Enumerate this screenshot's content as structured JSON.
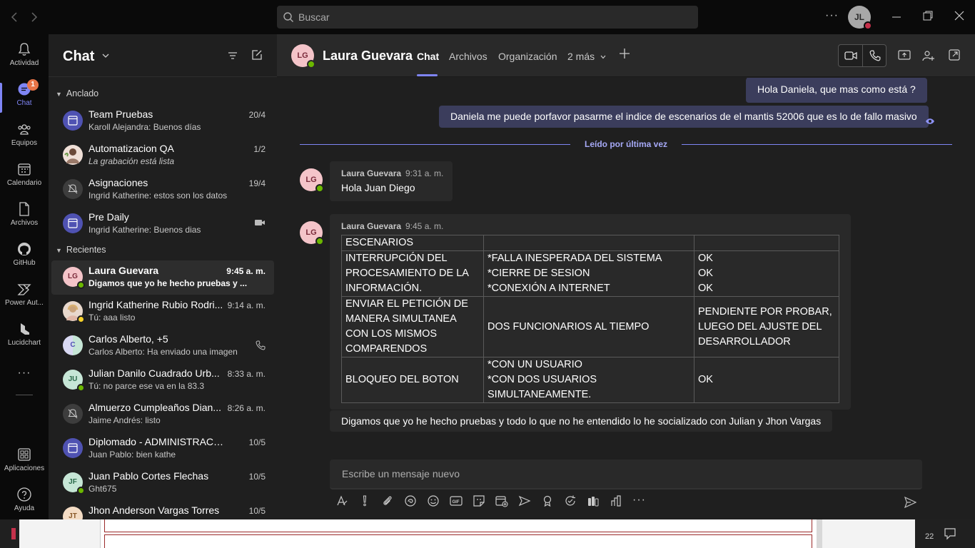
{
  "titlebar": {
    "search_placeholder": "Buscar",
    "more": "···",
    "user_initials": "JL"
  },
  "rail": {
    "items": [
      {
        "label": "Actividad",
        "icon": "bell-icon"
      },
      {
        "label": "Chat",
        "icon": "chat-icon",
        "badge": "1"
      },
      {
        "label": "Equipos",
        "icon": "teams-icon"
      },
      {
        "label": "Calendario",
        "icon": "calendar-icon"
      },
      {
        "label": "Archivos",
        "icon": "file-icon"
      },
      {
        "label": "GitHub",
        "icon": "github-icon"
      },
      {
        "label": "Power Aut...",
        "icon": "power-automate-icon"
      },
      {
        "label": "Lucidchart",
        "icon": "lucidchart-icon"
      }
    ],
    "more": "···",
    "bottom": [
      {
        "label": "Aplicaciones",
        "icon": "apps-icon"
      },
      {
        "label": "Ayuda",
        "icon": "help-icon"
      }
    ]
  },
  "chatlist": {
    "title": "Chat",
    "pinned_label": "Anclado",
    "recent_label": "Recientes",
    "pinned": [
      {
        "name": "Team Pruebas",
        "preview": "Karoll Alejandra: Buenos días",
        "time": "20/4"
      },
      {
        "name": "Automatizacion QA",
        "preview": "La grabación está lista",
        "time": "1/2"
      },
      {
        "name": "Asignaciones",
        "preview": "Ingrid Katherine: estos son los datos",
        "time": "19/4"
      },
      {
        "name": "Pre Daily",
        "preview": "Ingrid Katherine: Buenos dias",
        "time": ""
      }
    ],
    "recent": [
      {
        "name": "Laura Guevara",
        "initials": "LG",
        "preview": "Digamos que yo he hecho pruebas y ...",
        "time": "9:45 a. m."
      },
      {
        "name": "Ingrid Katherine Rubio Rodri...",
        "preview": "Tú: aaa listo",
        "time": "9:14 a. m."
      },
      {
        "name": "Carlos Alberto, +5",
        "initials": "C",
        "preview": "Carlos Alberto: Ha enviado una imagen",
        "time": ""
      },
      {
        "name": "Julian Danilo Cuadrado Urb...",
        "initials": "JU",
        "preview": "Tú: no parce ese va en la 83.3",
        "time": "8:33 a. m."
      },
      {
        "name": "Almuerzo Cumpleaños Dian...",
        "preview": "Jaime Andrés: listo",
        "time": "8:26 a. m."
      },
      {
        "name": "Diplomado - ADMINISTRACIÓN ...",
        "preview": "Juan Pablo: bien kathe",
        "time": "10/5"
      },
      {
        "name": "Juan Pablo Cortes Flechas",
        "initials": "JF",
        "preview": "Ght675",
        "time": "10/5"
      },
      {
        "name": "Jhon Anderson Vargas Torres",
        "initials": "JT",
        "preview": "",
        "time": "10/5"
      }
    ]
  },
  "header": {
    "initials": "LG",
    "name": "Laura Guevara",
    "tabs": [
      "Chat",
      "Archivos",
      "Organización",
      "2 más"
    ]
  },
  "messages": {
    "cut_top": "...",
    "mine": [
      "Hola Daniela, que mas como está ?",
      "Daniela me puede porfavor pasarme el indice de escenarios de el mantis 52006 que es lo de fallo masivo"
    ],
    "last_read": "Leído por última vez",
    "m1": {
      "initials": "LG",
      "sender": "Laura Guevara",
      "time": "9:31 a. m.",
      "text": "Hola Juan Diego"
    },
    "m2": {
      "initials": "LG",
      "sender": "Laura Guevara",
      "time": "9:45 a. m.",
      "table": [
        [
          "ESCENARIOS",
          "",
          ""
        ],
        [
          "INTERRUPCIÓN DEL PROCESAMIENTO DE LA INFORMACIÓN.",
          "*FALLA INESPERADA DEL SISTEMA\n*CIERRE DE SESION\n*CONEXIÓN A INTERNET",
          "OK\nOK\nOK"
        ],
        [
          "ENVIAR EL PETICIÓN DE MANERA SIMULTANEA CON LOS MISMOS COMPARENDOS",
          "DOS FUNCIONARIOS AL TIEMPO",
          "PENDIENTE POR PROBAR, LUEGO DEL AJUSTE DEL DESARROLLADOR"
        ],
        [
          "BLOQUEO DEL BOTON",
          "*CON UN USUARIO\n*CON DOS USUARIOS SIMULTANEAMENTE.",
          "OK"
        ]
      ]
    },
    "m3": "Digamos que yo he hecho pruebas y todo lo que no he entendido lo he socializado con Julian y Jhon Vargas"
  },
  "compose": {
    "placeholder": "Escribe un mensaje nuevo"
  },
  "taskbar": {
    "clock": "22"
  },
  "colors": {
    "accent": "#7f85f5",
    "online": "#6bb700",
    "busy": "#c4314b",
    "badge": "#e97548",
    "my_bubble": "#3b3d5c"
  }
}
